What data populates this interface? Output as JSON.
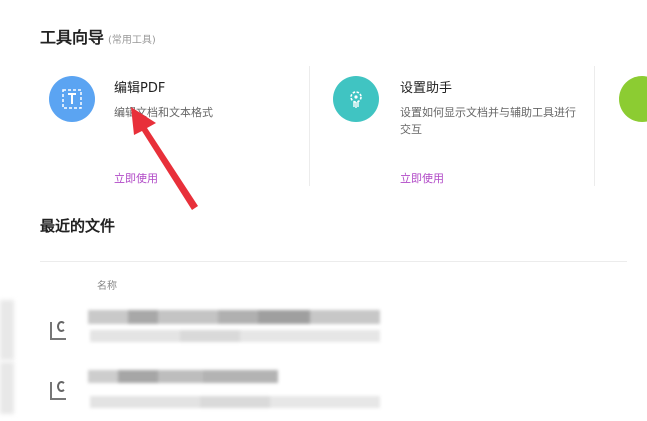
{
  "tools_section": {
    "title": "工具向导",
    "subtitle": "(常用工具)"
  },
  "cards": [
    {
      "title": "编辑PDF",
      "description": "编辑文档和文本格式",
      "action": "立即使用",
      "icon": "edit-text-icon",
      "color": "#5ba4f2"
    },
    {
      "title": "设置助手",
      "description": "设置如何显示文档并与辅助工具进行交互",
      "action": "立即使用",
      "icon": "gear-hand-icon",
      "color": "#40c4c2"
    }
  ],
  "partial_card_color": "#8ccc32",
  "recent": {
    "title": "最近的文件",
    "column_name": "名称"
  },
  "annotation_color": "#e8303a"
}
